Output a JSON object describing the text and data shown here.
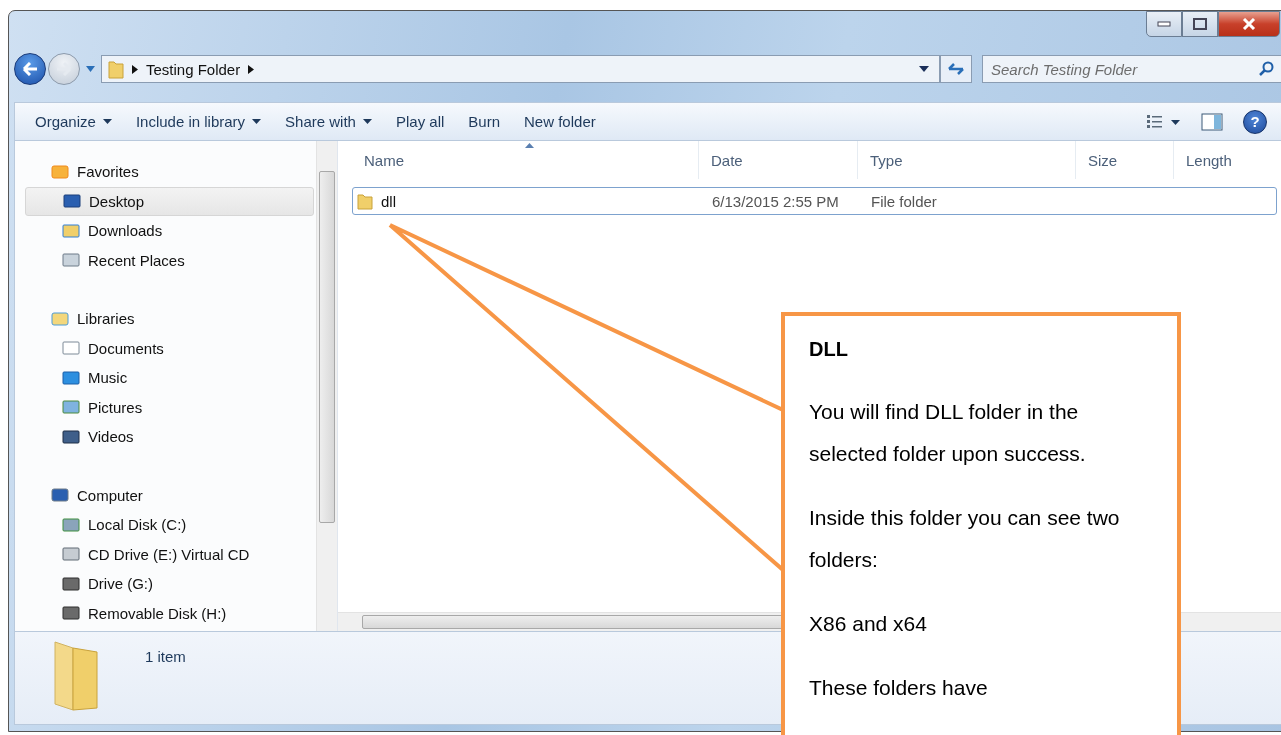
{
  "address": {
    "breadcrumb": [
      "Testing Folder"
    ],
    "search_placeholder": "Search Testing Folder"
  },
  "toolbar": [
    {
      "label": "Organize",
      "dropdown": true
    },
    {
      "label": "Include in library",
      "dropdown": true
    },
    {
      "label": "Share with",
      "dropdown": true
    },
    {
      "label": "Play all",
      "dropdown": false
    },
    {
      "label": "Burn",
      "dropdown": false
    },
    {
      "label": "New folder",
      "dropdown": false
    }
  ],
  "help_button": "?",
  "sidebar": [
    {
      "label": "Favorites",
      "kind": "star",
      "children": [
        {
          "label": "Desktop",
          "kind": "desktop",
          "selected": true
        },
        {
          "label": "Downloads",
          "kind": "downloads",
          "selected": false
        },
        {
          "label": "Recent Places",
          "kind": "recent",
          "selected": false
        }
      ]
    },
    {
      "label": "Libraries",
      "kind": "library",
      "children": [
        {
          "label": "Documents",
          "kind": "document",
          "selected": false
        },
        {
          "label": "Music",
          "kind": "music",
          "selected": false
        },
        {
          "label": "Pictures",
          "kind": "picture",
          "selected": false
        },
        {
          "label": "Videos",
          "kind": "video",
          "selected": false
        }
      ]
    },
    {
      "label": "Computer",
      "kind": "computer",
      "children": [
        {
          "label": "Local Disk (C:)",
          "kind": "disk",
          "selected": false
        },
        {
          "label": "CD Drive (E:) Virtual CD",
          "kind": "cd",
          "selected": false
        },
        {
          "label": "Drive (G:)",
          "kind": "removable",
          "selected": false
        },
        {
          "label": "Removable Disk (H:)",
          "kind": "removable",
          "selected": false
        }
      ]
    }
  ],
  "table": {
    "columns": [
      {
        "label": "Name",
        "sorted": true
      },
      {
        "label": "Date",
        "sorted": false
      },
      {
        "label": "Type",
        "sorted": false
      },
      {
        "label": "Size",
        "sorted": false
      },
      {
        "label": "Length",
        "sorted": false
      }
    ],
    "rows": [
      {
        "name": "dll",
        "date": "6/13/2015 2:55 PM",
        "type": "File folder",
        "selected": true
      }
    ]
  },
  "status_bar": {
    "count": "1 item"
  },
  "callout": {
    "title": "DLL",
    "paragraphs": [
      "You will find DLL folder in the selected folder upon success.",
      "Inside this folder you can see two folders:",
      "X86 and x64",
      "These folders have"
    ]
  }
}
